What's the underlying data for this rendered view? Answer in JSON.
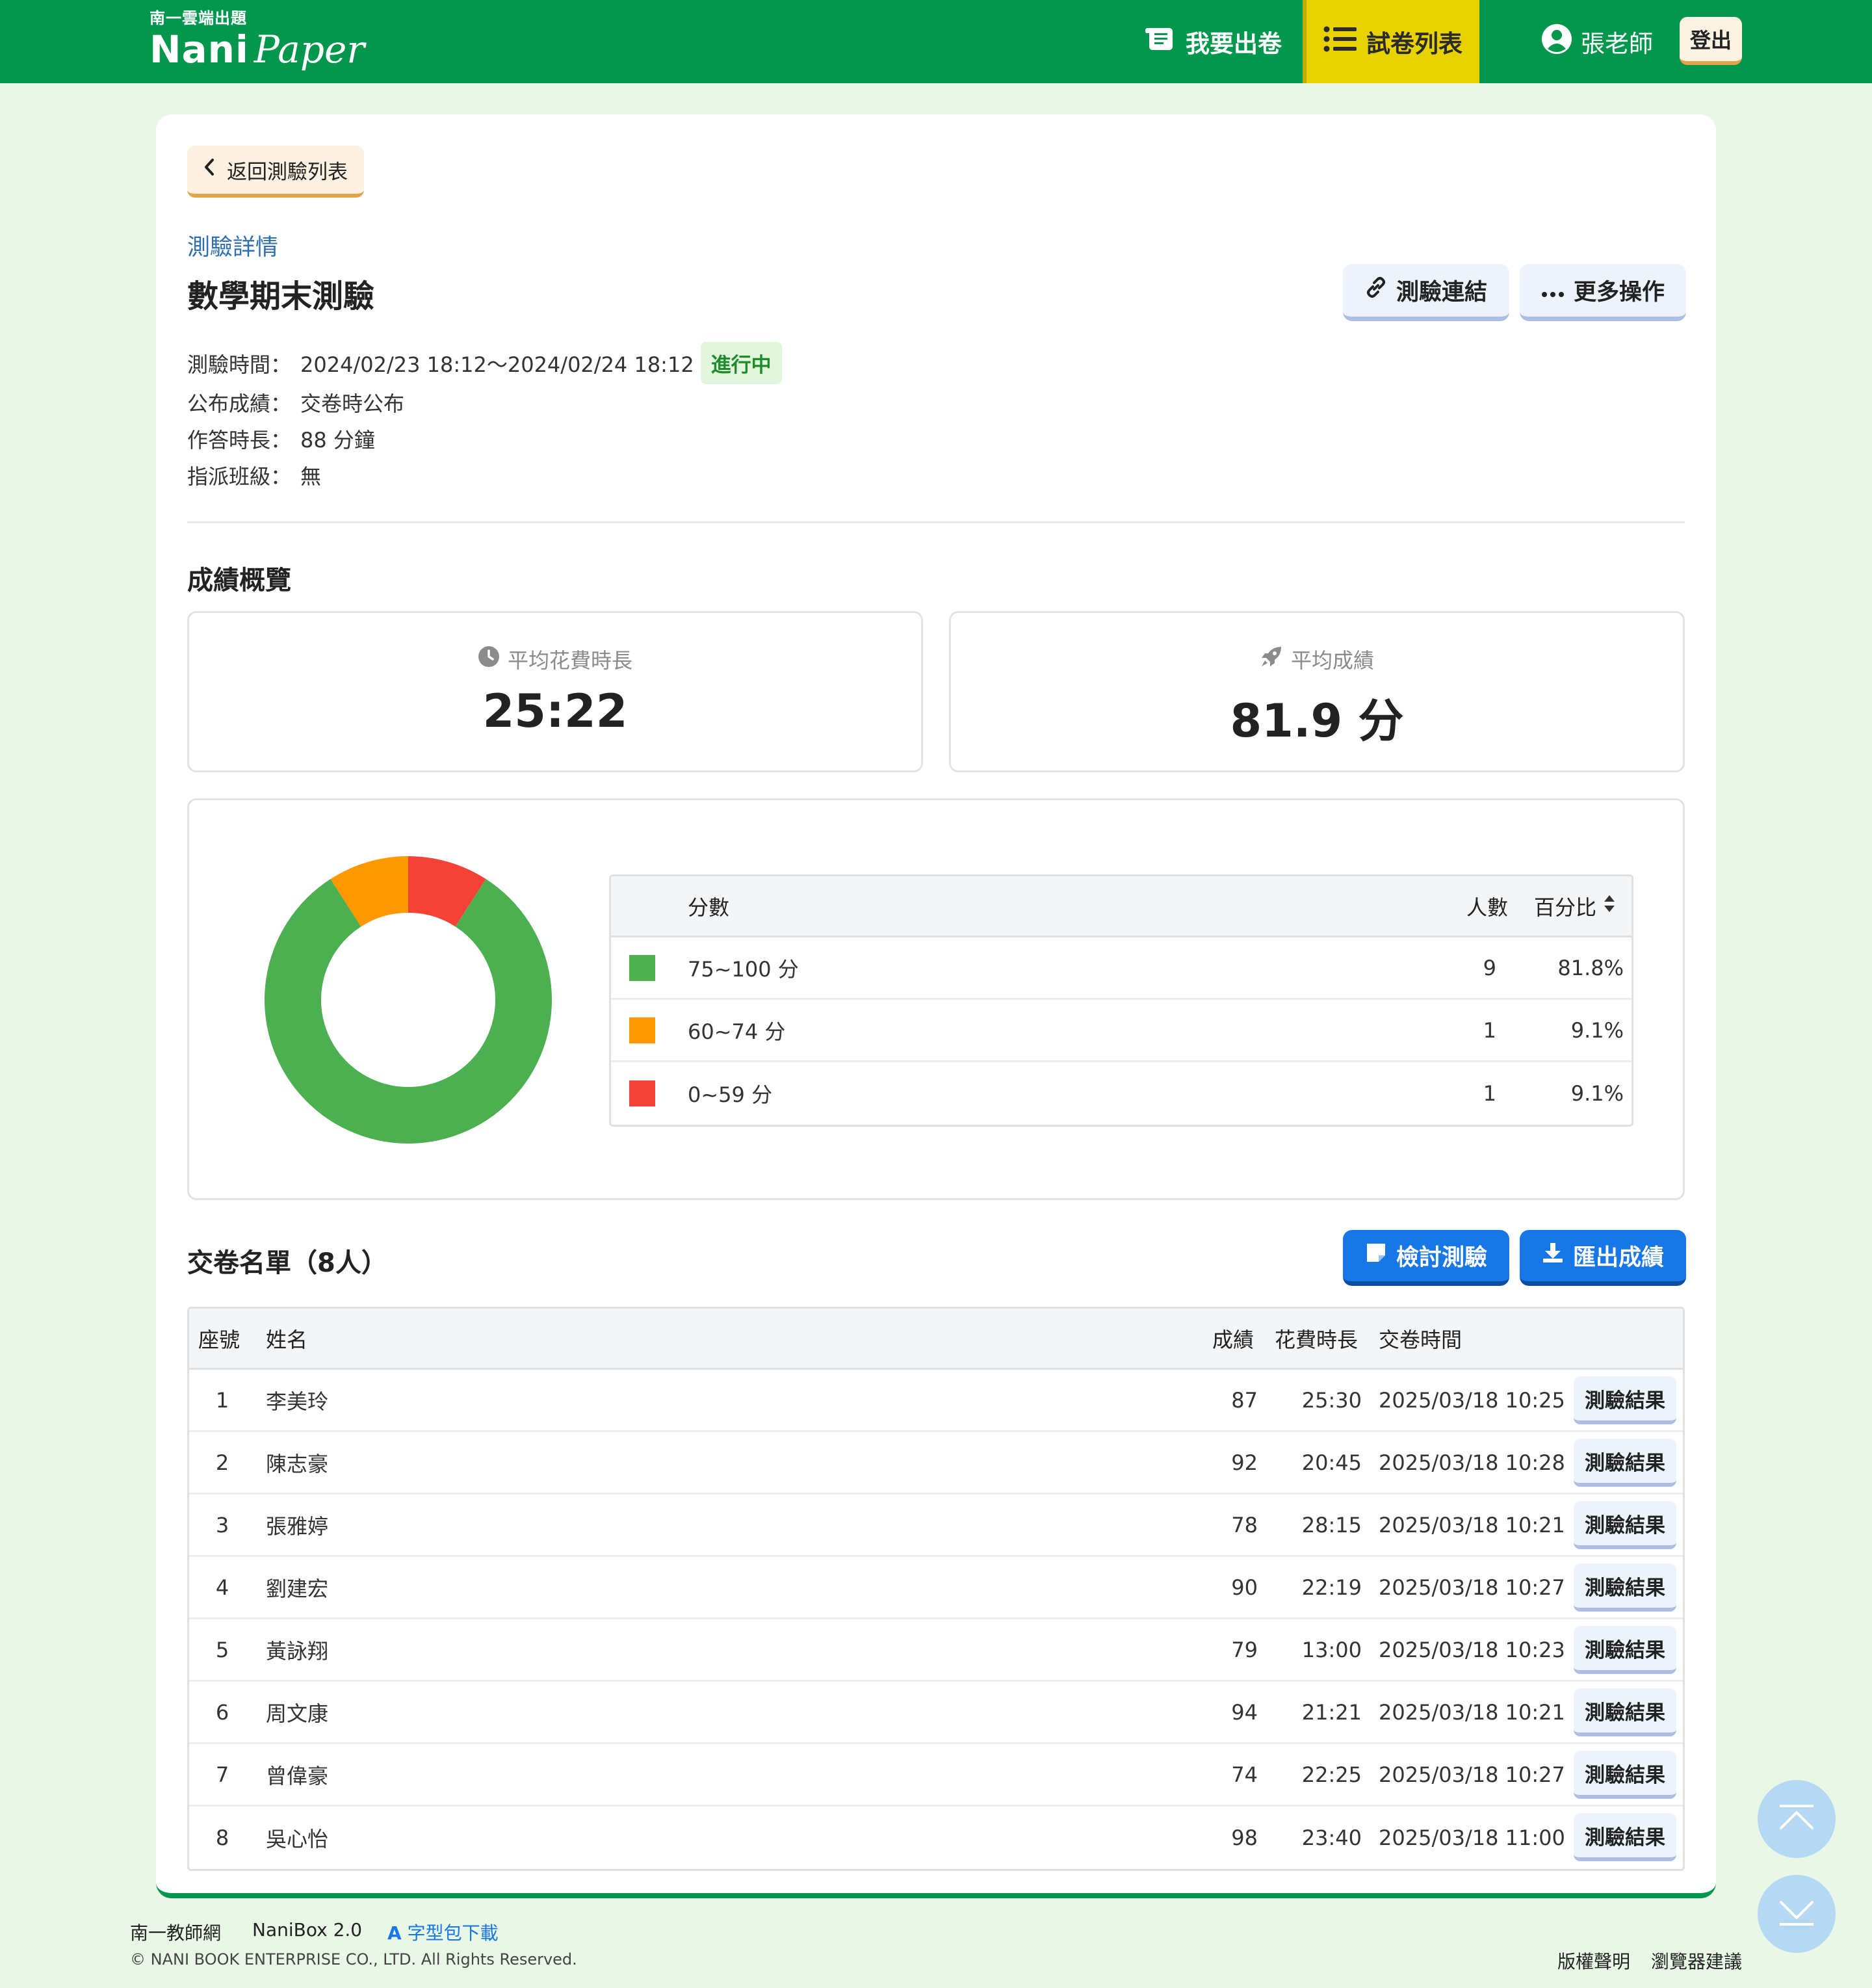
{
  "header": {
    "brand_tag": "南一雲端出題",
    "brand_name_bold": "Nani",
    "brand_name_light": "Paper",
    "nav_make": "我要出卷",
    "nav_list": "試卷列表",
    "user_name": "張老師",
    "logout": "登出",
    "colors": {
      "bar": "#03964d",
      "active": "#e8d300"
    }
  },
  "back_button": "返回測驗列表",
  "detail_label": "測驗詳情",
  "exam": {
    "title": "數學期末測驗",
    "link_button": "測驗連結",
    "more_button": "更多操作",
    "time_label": "測驗時間：",
    "time_value": "2024/02/23 18:12～2024/02/24 18:12",
    "status": "進行中",
    "publish_label": "公布成績：",
    "publish_value": "交卷時公布",
    "duration_label": "作答時長：",
    "duration_value": "88 分鐘",
    "class_label": "指派班級：",
    "class_value": "無"
  },
  "overview": {
    "title": "成績概覽",
    "avg_time_label": "平均花費時長",
    "avg_time_value": "25:22",
    "avg_score_label": "平均成績",
    "avg_score_value": "81.9 分"
  },
  "chart_data": {
    "type": "pie",
    "donut": true,
    "categories": [
      "75~100 分",
      "60~74 分",
      "0~59 分"
    ],
    "values": [
      81.8,
      9.1,
      9.1
    ],
    "colors": [
      "#4caf50",
      "#ff9800",
      "#f44336"
    ]
  },
  "distribution": {
    "headers": {
      "range": "分數",
      "count": "人數",
      "percent": "百分比"
    },
    "rows": [
      {
        "range": "75~100 分",
        "count": "9",
        "percent": "81.8%",
        "color": "#4caf50"
      },
      {
        "range": "60~74 分",
        "count": "1",
        "percent": "9.1%",
        "color": "#ff9800"
      },
      {
        "range": "0~59 分",
        "count": "1",
        "percent": "9.1%",
        "color": "#f44336"
      }
    ]
  },
  "submissions": {
    "title": "交卷名單（8人）",
    "review_button": "檢討測驗",
    "export_button": "匯出成績",
    "headers": {
      "seat": "座號",
      "name": "姓名",
      "score": "成績",
      "time": "花費時長",
      "submitted": "交卷時間"
    },
    "result_label": "測驗結果",
    "rows": [
      {
        "seat": "1",
        "name": "李美玲",
        "score": "87",
        "time": "25:30",
        "submitted": "2025/03/18 10:25"
      },
      {
        "seat": "2",
        "name": "陳志豪",
        "score": "92",
        "time": "20:45",
        "submitted": "2025/03/18 10:28"
      },
      {
        "seat": "3",
        "name": "張雅婷",
        "score": "78",
        "time": "28:15",
        "submitted": "2025/03/18 10:21"
      },
      {
        "seat": "4",
        "name": "劉建宏",
        "score": "90",
        "time": "22:19",
        "submitted": "2025/03/18 10:27"
      },
      {
        "seat": "5",
        "name": "黃詠翔",
        "score": "79",
        "time": "13:00",
        "submitted": "2025/03/18 10:23"
      },
      {
        "seat": "6",
        "name": "周文康",
        "score": "94",
        "time": "21:21",
        "submitted": "2025/03/18 10:21"
      },
      {
        "seat": "7",
        "name": "曾偉豪",
        "score": "74",
        "time": "22:25",
        "submitted": "2025/03/18 10:27"
      },
      {
        "seat": "8",
        "name": "吳心怡",
        "score": "98",
        "time": "23:40",
        "submitted": "2025/03/18 11:00"
      }
    ]
  },
  "footer": {
    "link1": "南一教師網",
    "link2": "NaniBox 2.0",
    "link3": "字型包下載",
    "link3_glyph": "A",
    "copyright": "© NANI BOOK ENTERPRISE CO., LTD. All Rights Reserved.",
    "link4": "版權聲明",
    "link5": "瀏覽器建議"
  }
}
